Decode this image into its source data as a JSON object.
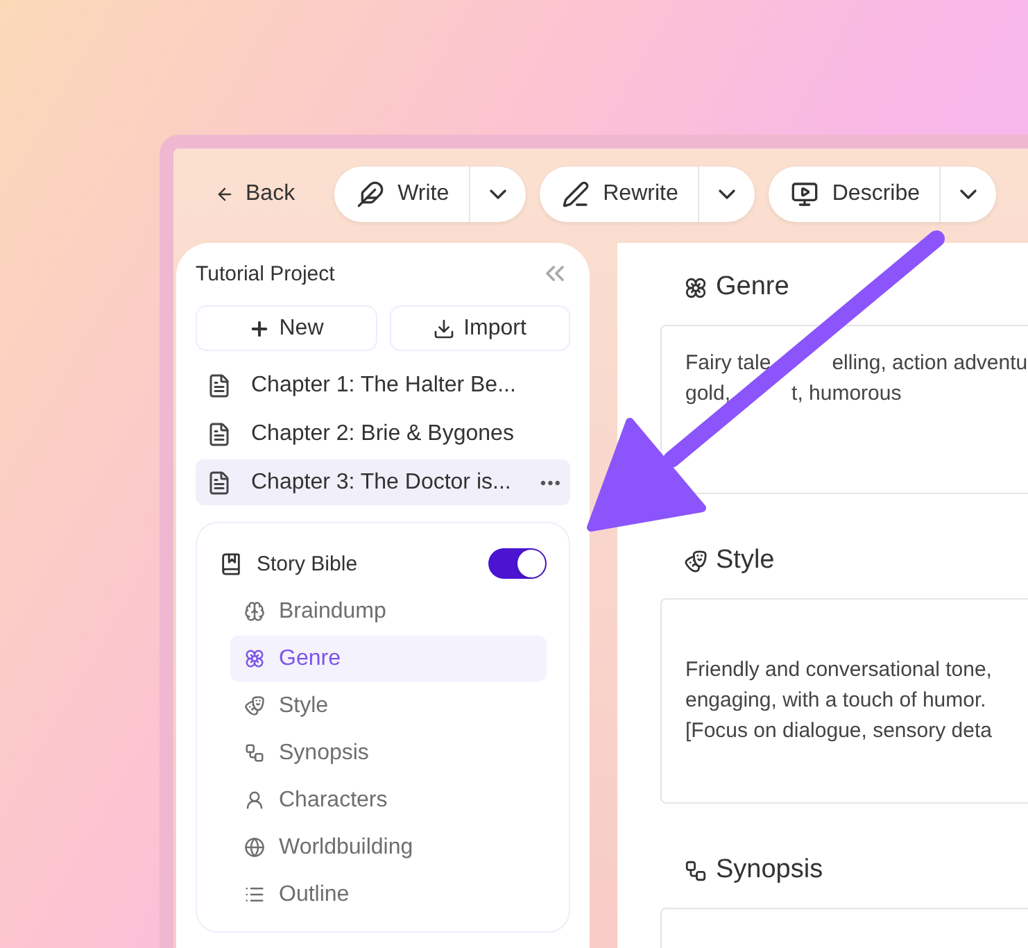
{
  "toolbar": {
    "back": "Back",
    "actions": [
      {
        "kind": "write",
        "label": "Write"
      },
      {
        "kind": "rewrite",
        "label": "Rewrite"
      },
      {
        "kind": "describe",
        "label": "Describe"
      }
    ]
  },
  "sidebar": {
    "project_title": "Tutorial Project",
    "new_button": "New",
    "import_button": "Import",
    "chapters": [
      {
        "title": "Chapter 1: The Halter Be...",
        "selected": false
      },
      {
        "title": "Chapter 2: Brie & Bygones",
        "selected": false
      },
      {
        "title": "Chapter 3: The Doctor is...",
        "selected": true,
        "menu": "•••"
      }
    ],
    "story_bible": {
      "title": "Story Bible",
      "on": true,
      "items": [
        {
          "kind": "braindump",
          "label": "Braindump",
          "selected": false
        },
        {
          "kind": "genre",
          "label": "Genre",
          "selected": true
        },
        {
          "kind": "style",
          "label": "Style",
          "selected": false
        },
        {
          "kind": "synopsis",
          "label": "Synopsis",
          "selected": false
        },
        {
          "kind": "characters",
          "label": "Characters",
          "selected": false
        },
        {
          "kind": "worldbuilding",
          "label": "Worldbuilding",
          "selected": false
        },
        {
          "kind": "outline",
          "label": "Outline",
          "selected": false
        }
      ]
    }
  },
  "sections": [
    {
      "kind": "genre",
      "title": "Genre",
      "lines": [
        [
          "Fairy tale",
          "elling, action adventu"
        ],
        [
          "gold,",
          "t, humorous"
        ]
      ]
    },
    {
      "kind": "style",
      "title": "Style",
      "lines": [
        [
          "Friendly and conversational tone,"
        ],
        [
          "engaging, with a touch of humor."
        ],
        [
          "[Focus on dialogue, sensory deta"
        ]
      ]
    },
    {
      "kind": "synopsis",
      "title": "Synopsis"
    }
  ]
}
